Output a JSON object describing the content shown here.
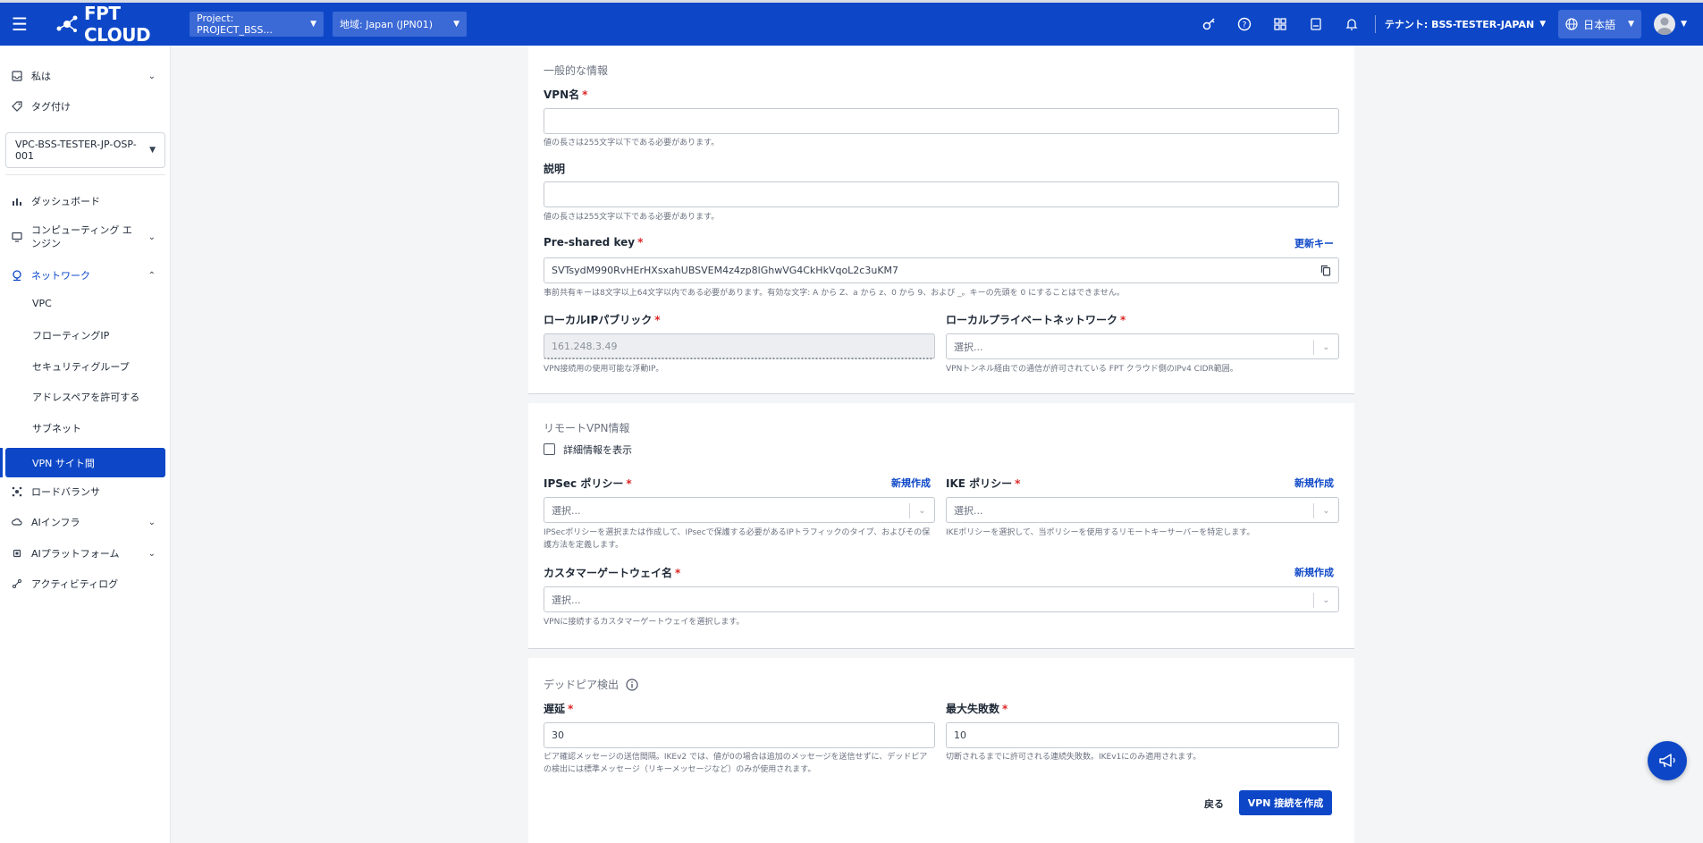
{
  "topbar": {
    "logo_text": "FPT CLOUD",
    "project_select": "Project: PROJECT_BSS...",
    "region_select": "地域: Japan (JPN01)",
    "tenant_label": "テナント: BSS-TESTER-JAPAN",
    "language": "日本語",
    "icons": [
      "menu-icon",
      "key-icon",
      "help-icon",
      "apps-icon",
      "book-icon",
      "bell-icon",
      "globe-icon",
      "user-icon"
    ]
  },
  "sidebar": {
    "items": [
      {
        "label": "私は",
        "icon": "inbox-icon"
      },
      {
        "label": "タグ付け",
        "icon": "tag-icon"
      },
      {
        "label": "ダッシュボード",
        "icon": "chart-icon"
      },
      {
        "label": "コンピューティング エンジン",
        "icon": "monitor-icon"
      },
      {
        "label": "ネットワーク",
        "icon": "network-icon"
      },
      {
        "label": "ロードバランサ",
        "icon": "balancer-icon"
      },
      {
        "label": "AIインフラ",
        "icon": "cloud-icon"
      },
      {
        "label": "AIプラットフォーム",
        "icon": "chip-icon"
      },
      {
        "label": "アクティビティログ",
        "icon": "log-icon"
      }
    ],
    "vpc_select": "VPC-BSS-TESTER-JP-OSP-001",
    "network_sub": [
      "VPC",
      "フローティングIP",
      "セキュリティグループ",
      "アドレスペアを許可する",
      "サブネット",
      "VPN サイト間"
    ]
  },
  "general": {
    "section_title": "一般的な情報",
    "vpn_name_label": "VPN名",
    "vpn_name_value": "",
    "vpn_name_hint": "値の長さは255文字以下である必要があります。",
    "desc_label": "説明",
    "desc_value": "",
    "desc_hint": "値の長さは255文字以下である必要があります。",
    "psk_label": "Pre-shared key",
    "psk_renew": "更新キー",
    "psk_value": "SVTsydM990RvHErHXsxahUBSVEM4z4zp8lGhwVG4CkHkVqoL2c3uKM7",
    "psk_hint": "事前共有キーは8文字以上64文字以内である必要があります。有効な文字: A から Z、a から z、0 から 9、および _。キーの先頭を 0 にすることはできません。",
    "local_ip_label": "ローカルIPパブリック",
    "local_ip_value": "161.248.3.49",
    "local_ip_hint": "VPN接続用の使用可能な浮動IP。",
    "local_net_label": "ローカルプライベートネットワーク",
    "local_net_placeholder": "選択...",
    "local_net_hint": "VPNトンネル経由での通信が許可されている FPT クラウド側のIPv4 CIDR範囲。"
  },
  "remote": {
    "section_title": "リモートVPN情報",
    "show_details": "詳細情報を表示",
    "ipsec_label": "IPSec ポリシー",
    "ipsec_new": "新規作成",
    "ipsec_placeholder": "選択...",
    "ipsec_hint": "IPSecポリシーを選択または作成して、IPsecで保護する必要があるIPトラフィックのタイプ、およびその保護方法を定義します。",
    "ike_label": "IKE ポリシー",
    "ike_new": "新規作成",
    "ike_placeholder": "選択...",
    "ike_hint": "IKEポリシーを選択して、当ポリシーを使用するリモートキーサーバーを特定します。",
    "cgw_label": "カスタマーゲートウェイ名",
    "cgw_new": "新規作成",
    "cgw_placeholder": "選択...",
    "cgw_hint": "VPNに接続するカスタマーゲートウェイを選択します。"
  },
  "dpd": {
    "section_title": "デッドピア検出",
    "delay_label": "遅延",
    "delay_value": "30",
    "delay_hint": "ピア確認メッセージの送信間隔。IKEv2 では、値が0の場合は追加のメッセージを送信せずに、デッドピアの検出には標準メッセージ（リキーメッセージなど）のみが使用されます。",
    "max_fail_label": "最大失敗数",
    "max_fail_value": "10",
    "max_fail_hint": "切断されるまでに許可される連続失敗数。IKEv1にのみ適用されます。"
  },
  "actions": {
    "back": "戻る",
    "create": "VPN 接続を作成"
  },
  "colors": {
    "brand": "#0d47c7",
    "required": "#dc2626"
  }
}
